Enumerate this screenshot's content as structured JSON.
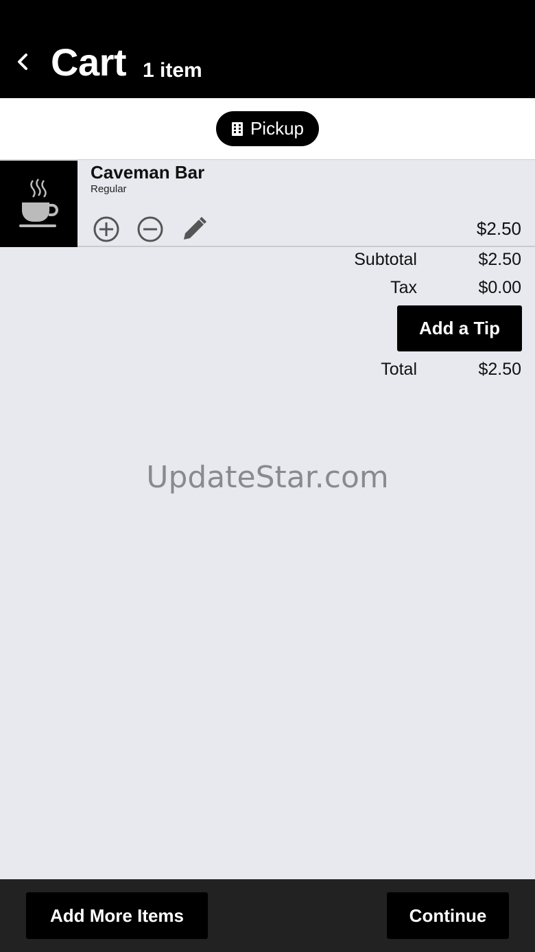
{
  "header": {
    "back_icon": "chevron-left-icon",
    "title": "Cart",
    "subtitle": "1 item"
  },
  "order_mode": {
    "icon": "building-icon",
    "label": "Pickup"
  },
  "cart_items": [
    {
      "name": "Caveman Bar",
      "variant": "Regular",
      "price": "$2.50",
      "image_icon": "coffee-cup-icon",
      "controls": [
        "plus-circle-icon",
        "minus-circle-icon",
        "pencil-icon"
      ]
    }
  ],
  "summary": {
    "subtotal_label": "Subtotal",
    "subtotal_value": "$2.50",
    "tax_label": "Tax",
    "tax_value": "$0.00",
    "tip_button": "Add a Tip",
    "total_label": "Total",
    "total_value": "$2.50"
  },
  "watermark": "UpdateStar.com",
  "footer": {
    "add_more_label": "Add More Items",
    "continue_label": "Continue"
  },
  "colors": {
    "header_bg": "#000000",
    "page_bg": "#e8e8ef",
    "footer_bg": "#222222",
    "button_bg": "#000000",
    "button_text": "#ffffff"
  }
}
